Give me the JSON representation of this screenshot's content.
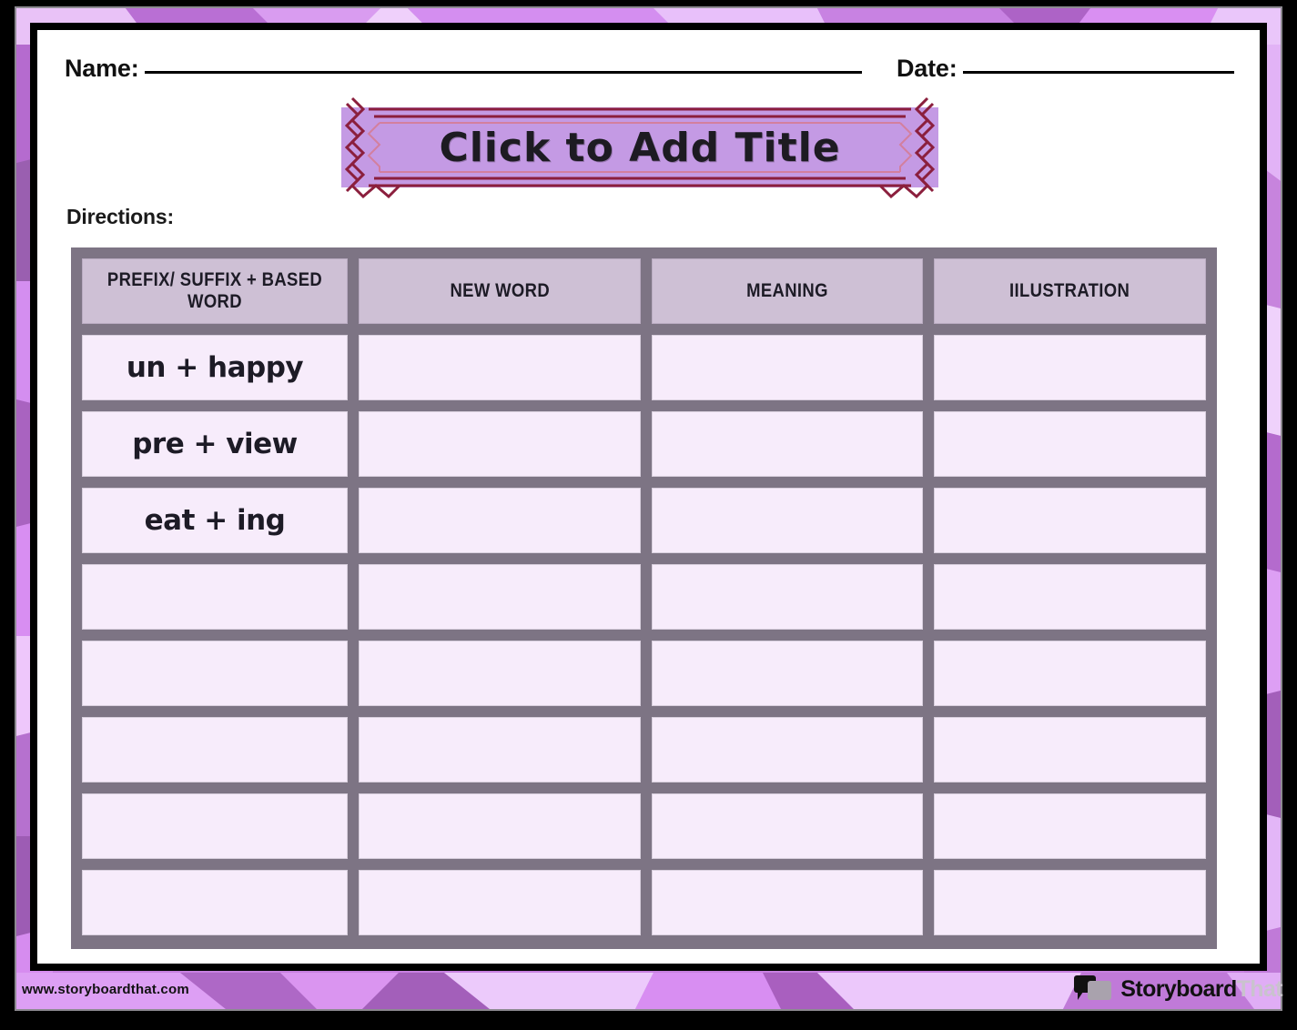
{
  "worksheet": {
    "name_label": "Name:",
    "date_label": "Date:",
    "title": "Click to Add Title",
    "directions_label": "Directions:"
  },
  "table": {
    "headers": [
      "PREFIX/ SUFFIX + BASED WORD",
      "NEW WORD",
      "MEANING",
      "IILUSTRATION"
    ],
    "rows": [
      {
        "cells": [
          "un + happy",
          "",
          "",
          ""
        ]
      },
      {
        "cells": [
          "pre + view",
          "",
          "",
          ""
        ]
      },
      {
        "cells": [
          "eat + ing",
          "",
          "",
          ""
        ]
      },
      {
        "cells": [
          "",
          "",
          "",
          ""
        ]
      },
      {
        "cells": [
          "",
          "",
          "",
          ""
        ]
      },
      {
        "cells": [
          "",
          "",
          "",
          ""
        ]
      },
      {
        "cells": [
          "",
          "",
          "",
          ""
        ]
      },
      {
        "cells": [
          "",
          "",
          "",
          ""
        ]
      }
    ]
  },
  "footer": {
    "watermark": "www.storyboardthat.com",
    "logo_text_dark": "Storyboard",
    "logo_text_light": "That"
  },
  "colors": {
    "border_purple": "#c77fe0",
    "border_purple_light": "#e4b4f5",
    "border_purple_dark": "#9a5fb0",
    "banner_fill": "#c49ae4",
    "banner_line": "#8b1f3d",
    "table_grid": "#7d7484",
    "header_cell": "#cec0d5",
    "body_cell": "#f7ecfb",
    "page": "#ffffff",
    "frame": "#000000"
  }
}
